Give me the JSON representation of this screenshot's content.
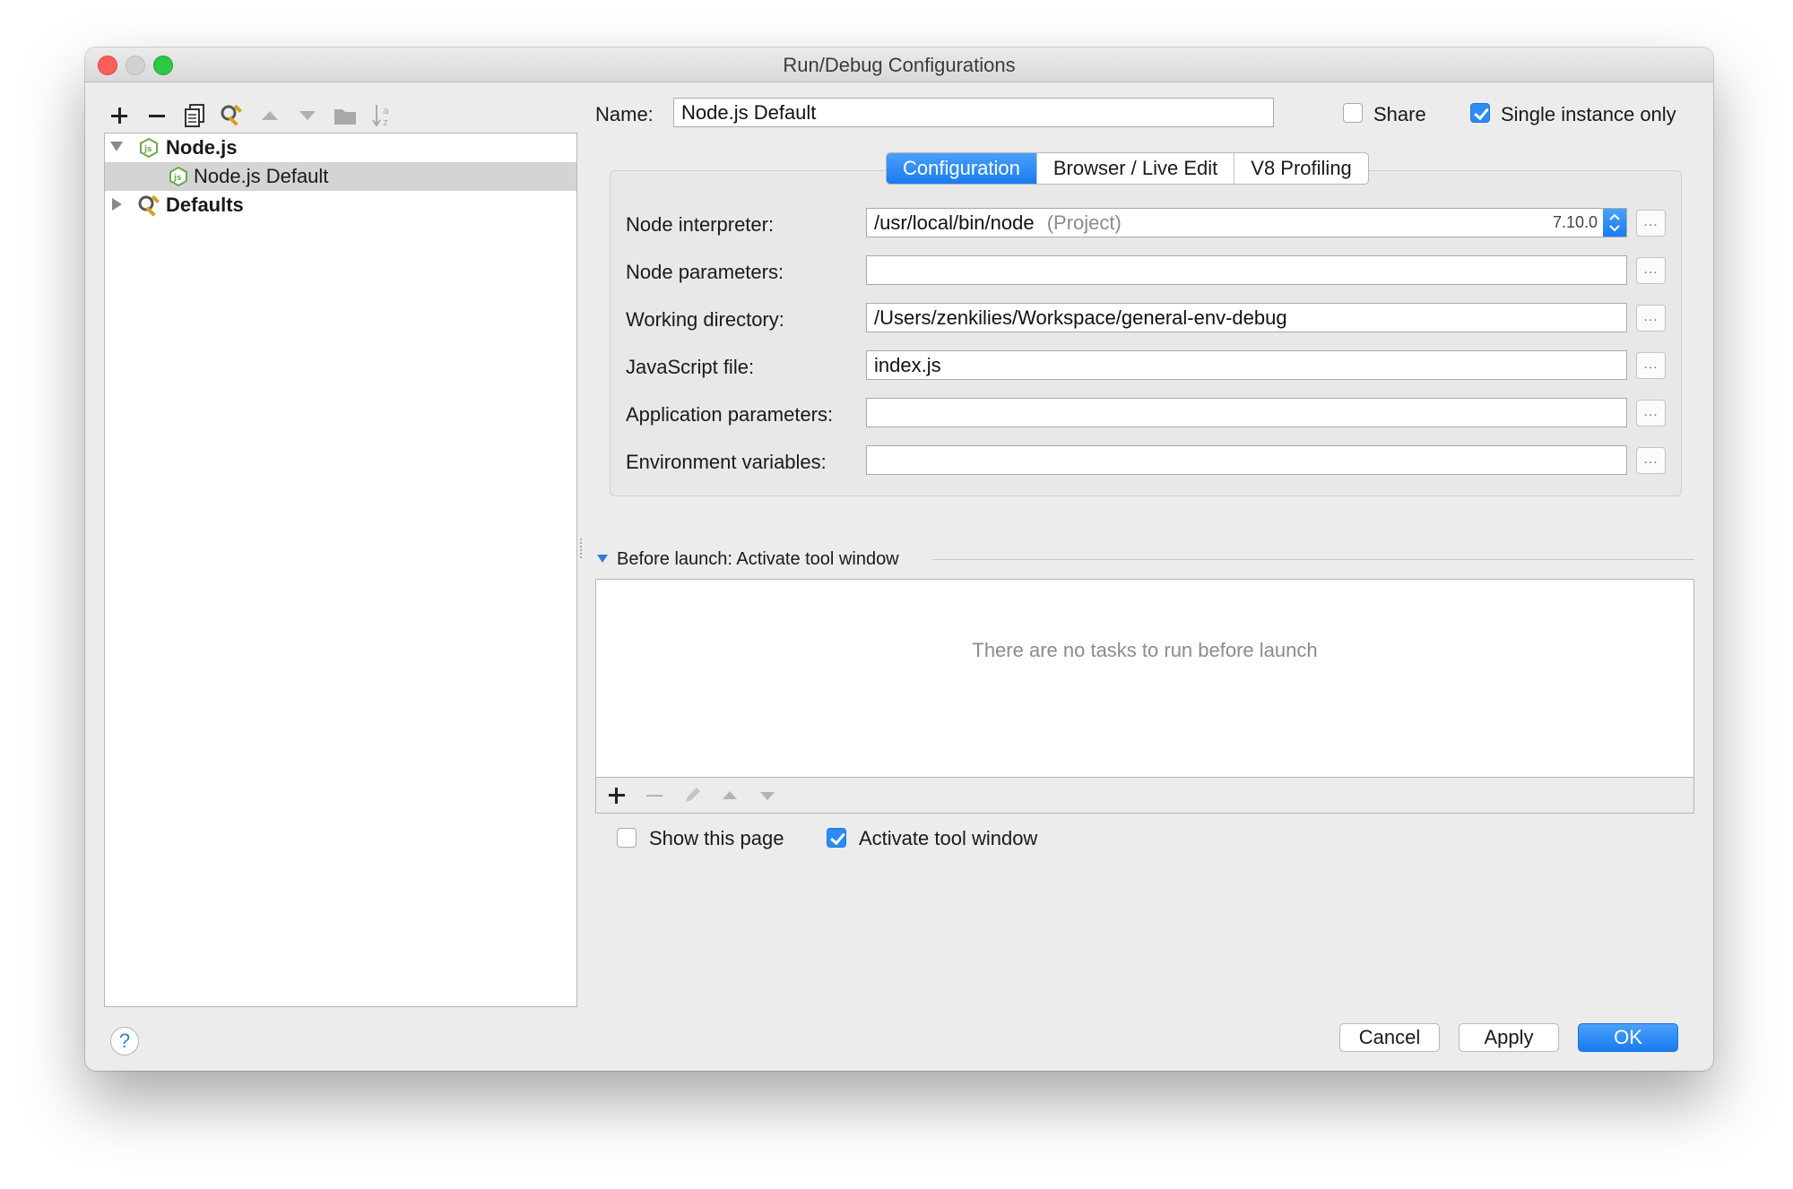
{
  "window": {
    "title": "Run/Debug Configurations"
  },
  "tree": {
    "items": [
      {
        "label": "Node.js",
        "expanded": true
      },
      {
        "label": "Node.js Default",
        "selected": true
      },
      {
        "label": "Defaults",
        "expanded": false
      }
    ]
  },
  "name": {
    "label": "Name:",
    "value": "Node.js Default"
  },
  "share": {
    "label": "Share",
    "checked": false
  },
  "single_instance": {
    "label": "Single instance only",
    "checked": true
  },
  "tabs": [
    {
      "label": "Configuration",
      "active": true
    },
    {
      "label": "Browser / Live Edit",
      "active": false
    },
    {
      "label": "V8 Profiling",
      "active": false
    }
  ],
  "form": {
    "node_interpreter": {
      "label": "Node interpreter:",
      "value": "/usr/local/bin/node",
      "hint": "(Project)",
      "version": "7.10.0"
    },
    "node_parameters": {
      "label": "Node parameters:",
      "value": ""
    },
    "working_directory": {
      "label": "Working directory:",
      "value": "/Users/zenkilies/Workspace/general-env-debug"
    },
    "javascript_file": {
      "label": "JavaScript file:",
      "value": "index.js"
    },
    "application_parameters": {
      "label": "Application parameters:",
      "value": ""
    },
    "environment_variables": {
      "label": "Environment variables:",
      "value": ""
    },
    "browse_label": "..."
  },
  "before_launch": {
    "header": "Before launch: Activate tool window",
    "empty_text": "There are no tasks to run before launch"
  },
  "show_page": {
    "label": "Show this page",
    "checked": false
  },
  "activate_tool": {
    "label": "Activate tool window",
    "checked": true
  },
  "buttons": {
    "cancel": "Cancel",
    "apply": "Apply",
    "ok": "OK",
    "help": "?"
  },
  "colors": {
    "accent": "#2d8bf4",
    "node_green": "#6aa84f"
  }
}
